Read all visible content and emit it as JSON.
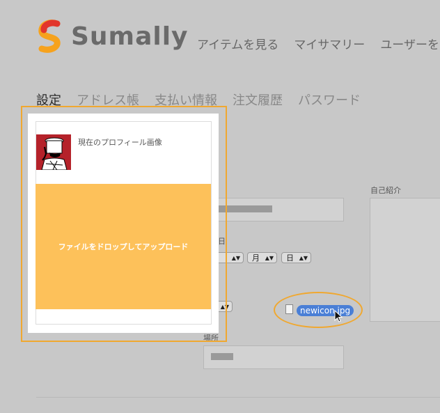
{
  "brand": {
    "name": "Sumally",
    "colors": {
      "accent": "#f0a830",
      "dropzone": "#fdc15a",
      "file_pill": "#4a7fd6",
      "logo_red": "#e2362b",
      "logo_orange": "#f6a21d"
    }
  },
  "topnav": [
    "アイテムを見る",
    "マイサマリー",
    "ユーザーを"
  ],
  "tabs": [
    {
      "label": "設定",
      "active": true
    },
    {
      "label": "アドレス帳",
      "active": false
    },
    {
      "label": "支払い情報",
      "active": false
    },
    {
      "label": "注文履歴",
      "active": false
    },
    {
      "label": "パスワード",
      "active": false
    }
  ],
  "form": {
    "birthday_label_fragment": "日",
    "month_label": "月",
    "day_label": "日",
    "bio_label": "自己紹介",
    "location_label": "場所"
  },
  "upload_dialog": {
    "current_image_label": "現在のプロフィール画像",
    "dropzone_text": "ファイルをドロップしてアップロード"
  },
  "drag": {
    "filename": "newicon.jpg"
  },
  "icons": [
    "sumally-logo-icon",
    "file-icon",
    "pointer-cursor-icon",
    "avatar-image"
  ]
}
